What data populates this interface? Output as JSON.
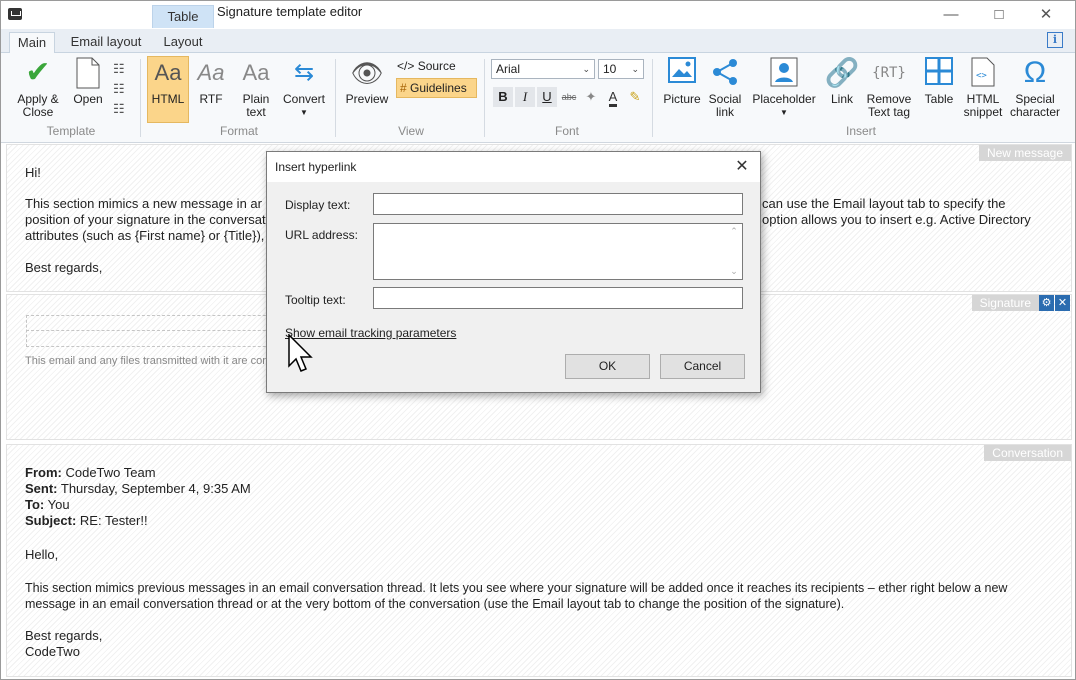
{
  "window": {
    "title": "Signature template editor",
    "context_tab": "Table"
  },
  "tabs": [
    {
      "label": "Main"
    },
    {
      "label": "Email layout"
    },
    {
      "label": "Layout"
    }
  ],
  "ribbon": {
    "template": {
      "apply_close": "Apply & Close",
      "open": "Open",
      "group": "Template"
    },
    "format": {
      "html": "HTML",
      "rtf": "RTF",
      "plain": "Plain text",
      "convert": "Convert",
      "group": "Format",
      "aa": "Aa"
    },
    "view": {
      "preview": "Preview",
      "source": "Source",
      "guidelines": "Guidelines",
      "group": "View"
    },
    "font": {
      "family": "Arial",
      "size": "10",
      "group": "Font",
      "bold": "B",
      "italic": "I",
      "underline": "U",
      "strike": "abc"
    },
    "insert": {
      "picture": "Picture",
      "social": "Social link",
      "placeholder": "Placeholder",
      "link": "Link",
      "remove_rt": "Remove Text tag",
      "table": "Table",
      "html_snippet": "HTML snippet",
      "special": "Special character",
      "group": "Insert",
      "rt": "RT"
    }
  },
  "new_message": {
    "label": "New message",
    "greeting": "Hi!",
    "line1a": "This section mimics a new message in ar",
    "line1b": "can use the Email layout tab to specify the",
    "line2a": "position of your signature in the conversat",
    "line2b": "option allows you to insert e.g. Active Directory",
    "line3": "attributes (such as {First name} or {Title}),",
    "closing": "Best regards,"
  },
  "signature": {
    "label": "Signature",
    "disclaimer": "This email and any files transmitted with it are con"
  },
  "conversation": {
    "label": "Conversation",
    "from_label": "From:",
    "from": "CodeTwo Team",
    "sent_label": "Sent:",
    "sent": "Thursday, September 4, 9:35 AM",
    "to_label": "To:",
    "to": "You",
    "subject_label": "Subject:",
    "subject": "RE: Tester!!",
    "hello": "Hello,",
    "body1": "This section mimics previous messages in an email conversation thread. It lets you see where your signature will be added once it reaches its recipients – ether right below a new",
    "body2": "message in an email conversation thread or at the very bottom of the conversation (use the Email layout tab to change the position of the signature).",
    "regards": "Best regards,",
    "sender": "CodeTwo"
  },
  "dialog": {
    "title": "Insert hyperlink",
    "display_text_label": "Display text:",
    "url_label": "URL address:",
    "tooltip_label": "Tooltip text:",
    "tracking_link": "Show email tracking parameters",
    "ok": "OK",
    "cancel": "Cancel"
  }
}
